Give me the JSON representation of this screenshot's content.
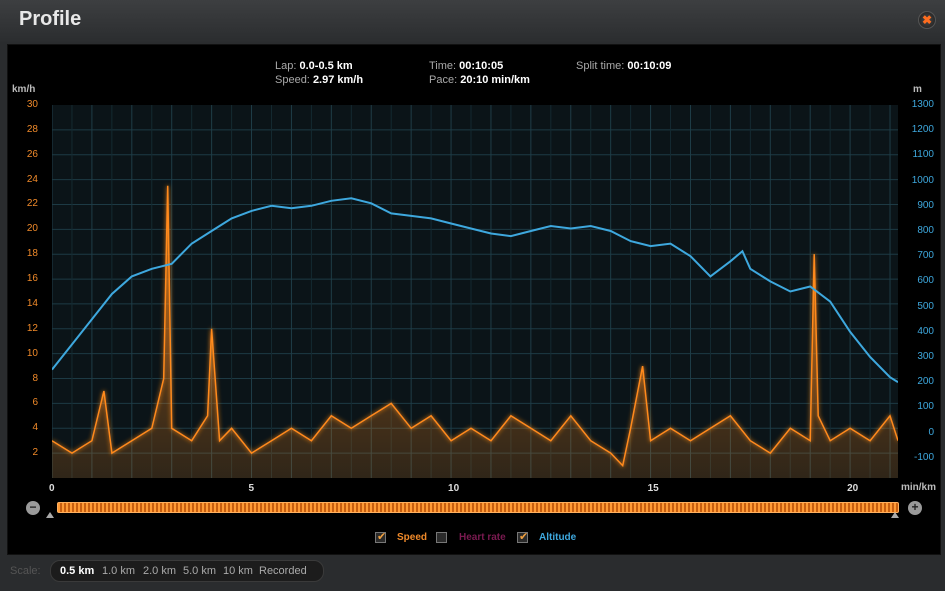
{
  "window": {
    "title": "Profile",
    "close_icon": "✖"
  },
  "stats": {
    "lap_label": "Lap:",
    "lap_value": "0.0-0.5 km",
    "speed_label": "Speed:",
    "speed_value": "2.97 km/h",
    "time_label": "Time:",
    "time_value": "00:10:05",
    "pace_label": "Pace:",
    "pace_value": "20:10 min/km",
    "split_label": "Split time:",
    "split_value": "00:10:09"
  },
  "axes": {
    "left_unit": "km/h",
    "right_unit": "m",
    "x_unit": "min/km",
    "left_ticks": [
      "30",
      "28",
      "26",
      "24",
      "22",
      "20",
      "18",
      "16",
      "14",
      "12",
      "10",
      "8",
      "6",
      "4",
      "2"
    ],
    "right_ticks": [
      "1300",
      "1200",
      "1100",
      "1000",
      "900",
      "800",
      "700",
      "600",
      "500",
      "400",
      "300",
      "200",
      "100",
      "0",
      "-100"
    ],
    "x_ticks": [
      "0",
      "5",
      "10",
      "15",
      "20"
    ]
  },
  "legend": {
    "speed": "Speed",
    "heart_rate": "Heart rate",
    "altitude": "Altitude"
  },
  "scale": {
    "label": "Scale:",
    "options": [
      "0.5 km",
      "1.0 km",
      "2.0 km",
      "5.0 km",
      "10 km",
      "Recorded"
    ],
    "selected": "0.5 km"
  },
  "colors": {
    "speed": "#ff8a1c",
    "altitude": "#3ea8de",
    "heart_rate": "#8a1a5a"
  },
  "chart_data": {
    "type": "line",
    "x_label": "min/km",
    "x_range": [
      0,
      21.2
    ],
    "speed_ylim": [
      0,
      30
    ],
    "altitude_ylim": [
      -180,
      1300
    ],
    "altitude": {
      "x": [
        0,
        0.5,
        1,
        1.5,
        2,
        2.5,
        3,
        3.5,
        4,
        4.5,
        5,
        5.5,
        6,
        6.5,
        7,
        7.5,
        8,
        8.5,
        9,
        9.5,
        10,
        10.5,
        11,
        11.5,
        12,
        12.5,
        13,
        13.5,
        14,
        14.5,
        15,
        15.5,
        16,
        16.5,
        17,
        17.3,
        17.5,
        18,
        18.5,
        19,
        19.5,
        20,
        20.5,
        21,
        21.2
      ],
      "y": [
        250,
        350,
        450,
        550,
        620,
        650,
        670,
        750,
        800,
        850,
        880,
        900,
        890,
        900,
        920,
        930,
        910,
        870,
        860,
        850,
        830,
        810,
        790,
        780,
        800,
        820,
        810,
        820,
        800,
        760,
        740,
        750,
        700,
        620,
        680,
        720,
        650,
        600,
        560,
        580,
        520,
        400,
        300,
        220,
        200
      ]
    },
    "speed": {
      "x": [
        0,
        0.5,
        1,
        1.3,
        1.5,
        2,
        2.5,
        2.8,
        2.9,
        3,
        3.5,
        3.9,
        4,
        4.2,
        4.5,
        5,
        5.5,
        6,
        6.5,
        7,
        7.5,
        8,
        8.5,
        9,
        9.5,
        10,
        10.5,
        11,
        11.5,
        12,
        12.5,
        13,
        13.5,
        14,
        14.3,
        14.5,
        14.8,
        15,
        15.5,
        16,
        16.5,
        17,
        17.5,
        18,
        18.5,
        19,
        19.1,
        19.2,
        19.5,
        20,
        20.5,
        21,
        21.2
      ],
      "y": [
        3,
        2,
        3,
        7,
        2,
        3,
        4,
        8,
        23.5,
        4,
        3,
        5,
        12,
        3,
        4,
        2,
        3,
        4,
        3,
        5,
        4,
        5,
        6,
        4,
        5,
        3,
        4,
        3,
        5,
        4,
        3,
        5,
        3,
        2,
        1,
        4,
        9,
        3,
        4,
        3,
        4,
        5,
        3,
        2,
        4,
        3,
        18,
        5,
        3,
        4,
        3,
        5,
        3
      ]
    }
  }
}
